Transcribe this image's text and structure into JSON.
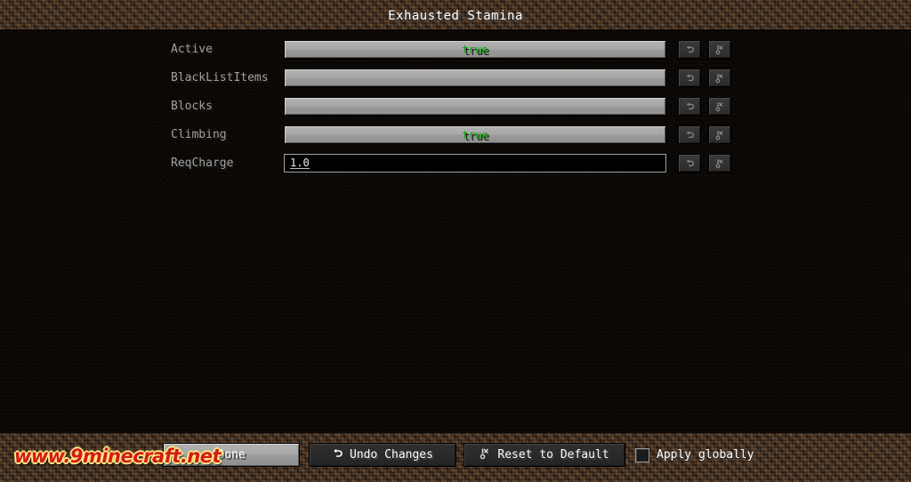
{
  "window": {
    "title": "Exhausted Stamina"
  },
  "options": [
    {
      "label": "Active",
      "control": "button",
      "value": "true",
      "value_kind": "true",
      "undo_icon": "undo-arrow-icon",
      "reset_icon": "reset-default-icon"
    },
    {
      "label": "BlackListItems",
      "control": "button",
      "value": "",
      "value_kind": "plain",
      "undo_icon": "undo-arrow-icon",
      "reset_icon": "reset-default-icon"
    },
    {
      "label": "Blocks",
      "control": "button",
      "value": "",
      "value_kind": "plain",
      "undo_icon": "undo-arrow-icon",
      "reset_icon": "reset-default-icon"
    },
    {
      "label": "Climbing",
      "control": "button",
      "value": "true",
      "value_kind": "true",
      "undo_icon": "undo-arrow-icon",
      "reset_icon": "reset-default-icon"
    },
    {
      "label": "ReqCharge",
      "control": "field",
      "value": "1.0",
      "value_kind": "plain",
      "undo_icon": "undo-arrow-icon",
      "reset_icon": "reset-default-icon"
    }
  ],
  "footer": {
    "done_label": "Done",
    "undo_changes_label": "Undo Changes",
    "undo_changes_icon": "undo-arrow-icon",
    "reset_default_label": "Reset to Default",
    "reset_default_icon": "reset-default-icon",
    "apply_globally_label": "Apply globally",
    "apply_globally_checked": false
  },
  "watermark": {
    "text": "www.9minecraft.net"
  },
  "colors": {
    "true_value": "#00a000",
    "label_text": "#a0a0a0",
    "title_text": "#ffffff",
    "watermark": "#d21a1a",
    "dirt": "#36251a"
  }
}
